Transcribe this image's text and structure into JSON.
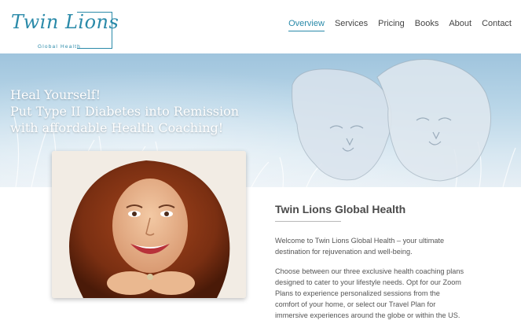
{
  "header": {
    "logo_text": "Twin Lions",
    "logo_subtitle": "Global Health",
    "nav": [
      {
        "label": "Overview",
        "active": true
      },
      {
        "label": "Services",
        "active": false
      },
      {
        "label": "Pricing",
        "active": false
      },
      {
        "label": "Books",
        "active": false
      },
      {
        "label": "About",
        "active": false
      },
      {
        "label": "Contact",
        "active": false
      }
    ]
  },
  "hero": {
    "lines": [
      "Heal Yourself!",
      "Put Type II Diabetes into Remission",
      "with affordable Health Coaching!"
    ]
  },
  "main": {
    "title": "Twin Lions Global Health",
    "paragraph1_lines": [
      "Welcome to Twin Lions Global Health – your ultimate",
      "destination for rejuvenation and well-being."
    ],
    "paragraph2_lines": [
      "Choose between our three exclusive health coaching plans",
      "designed to cater to your lifestyle needs. Opt for our Zoom",
      "Plans to experience personalized sessions from the",
      "comfort of your home, or select our Travel Plan for",
      "immersive experiences around the globe or within the US."
    ]
  },
  "colors": {
    "accent": "#2a8aa9",
    "hero_sky": "#b9d6e8",
    "text": "#555555"
  }
}
